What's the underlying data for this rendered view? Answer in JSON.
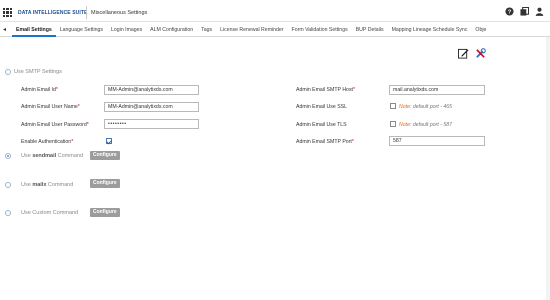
{
  "header": {
    "suite_name": "DATA INTELLIGENCE SUITE",
    "page_title": "Miscellaneous Settings",
    "icons": [
      "help-icon",
      "copy-icon",
      "user-icon"
    ]
  },
  "tabs": [
    {
      "label": "Email Settings",
      "active": true
    },
    {
      "label": "Language Settings"
    },
    {
      "label": "Login Images"
    },
    {
      "label": "ALM Configuration"
    },
    {
      "label": "Tags"
    },
    {
      "label": "License Renewal Reminder"
    },
    {
      "label": "Form Validation Settings"
    },
    {
      "label": "BUP Details"
    },
    {
      "label": "Mapping Lineage Schedule Sync"
    },
    {
      "label": "Obje"
    }
  ],
  "toolbar": {
    "icons": [
      "edit-icon",
      "tools-icon"
    ]
  },
  "smtp": {
    "radio_label": "Use SMTP Settings",
    "admin_email_id_label": "Admin Email Id",
    "admin_email_id_value": "MM-Admin@analytixds.com",
    "admin_user_name_label": "Admin Email User Name",
    "admin_user_name_value": "MM-Admin@analytixds.com",
    "admin_password_label": "Admin Email User Password",
    "admin_password_value": "••••••••",
    "enable_auth_label": "Enable Authentication",
    "enable_auth_checked": true,
    "smtp_host_label": "Admin Email SMTP Host",
    "smtp_host_value": "mail.analytixds.com",
    "use_ssl_label": "Admin Email Use SSL",
    "use_ssl_note_key": "Note:",
    "use_ssl_note": " default port - 465",
    "use_tls_label": "Admin Email Use TLS",
    "use_tls_note_key": "Note:",
    "use_tls_note": " default port - 587",
    "smtp_port_label": "Admin Email SMTP Port",
    "smtp_port_value": "587",
    "required_mark": "*"
  },
  "sendmail": {
    "prefix": "Use ",
    "command": "sendmail",
    "suffix": " Command",
    "checked": true,
    "configure_label": "Configure"
  },
  "mailx": {
    "prefix": "Use ",
    "command": "mailx",
    "suffix": " Command",
    "configure_label": "Configure"
  },
  "custom": {
    "label": "Use Custom Command",
    "configure_label": "Configure"
  },
  "colors": {
    "accent": "#1b74c5",
    "required": "#d0021b",
    "note": "#e56e1f",
    "button": "#9c9c9c"
  }
}
